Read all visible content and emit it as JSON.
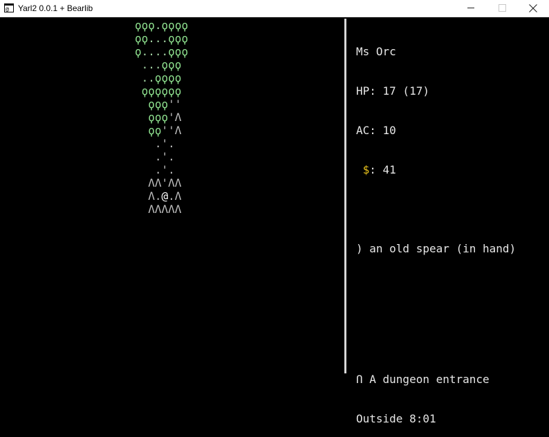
{
  "window": {
    "title": "Yarl2 0.0.1 + Bearlib",
    "icon": "terminal-app-icon",
    "controls": [
      "minimize-icon",
      "maximize-icon",
      "close-icon"
    ]
  },
  "map": {
    "rows": [
      [
        [
          "g",
          "ϙϙϙ"
        ],
        [
          "d",
          "."
        ],
        [
          "g",
          "ϙϙϙϙ"
        ]
      ],
      [
        [
          "g",
          "ϙϙ"
        ],
        [
          "d",
          "..."
        ],
        [
          "g",
          "ϙϙϙ"
        ]
      ],
      [
        [
          "g",
          "ϙ"
        ],
        [
          "d",
          "...."
        ],
        [
          "g",
          "ϙϙϙ"
        ]
      ],
      [
        [
          "d",
          " ..."
        ],
        [
          "g",
          "ϙϙϙ"
        ]
      ],
      [
        [
          "d",
          " .."
        ],
        [
          "g",
          "ϙϙϙϙ"
        ]
      ],
      [
        [
          "g",
          " ϙϙϙϙϙϙ"
        ]
      ],
      [
        [
          "g",
          "  ϙϙϙ"
        ],
        [
          "w",
          "''"
        ]
      ],
      [
        [
          "g",
          "  ϙϙϙ"
        ],
        [
          "w",
          "'Λ"
        ]
      ],
      [
        [
          "g",
          "  ϙϙ"
        ],
        [
          "w",
          "''Λ"
        ]
      ],
      [
        [
          "w",
          "   .'."
        ]
      ],
      [
        [
          "w",
          "   .'."
        ]
      ],
      [
        [
          "w",
          "   .'."
        ]
      ],
      [
        [
          "w",
          "  ΛΛ'ΛΛ"
        ]
      ],
      [
        [
          "w",
          "  Λ."
        ],
        [
          "p",
          "@"
        ],
        [
          "w",
          ".Λ"
        ]
      ],
      [
        [
          "w",
          "  ΛΛΛΛΛ"
        ]
      ]
    ],
    "colors": {
      "tree": "#8ee08e",
      "grass": "#a7d7a7",
      "terrain": "#bdbdbd",
      "player": "#ffffff"
    }
  },
  "stats": {
    "name": "Ms Orc",
    "hp_line": "HP: 17 (17)",
    "ac_line": "AC: 10",
    "gold_symbol": "$",
    "gold_rest": ": 41",
    "gold_color": "#e8c21c"
  },
  "equipment": {
    "line": ") an old spear (in hand)"
  },
  "location": {
    "feature_line": "Ո A dungeon entrance",
    "area_line": "Outside 8:01"
  }
}
